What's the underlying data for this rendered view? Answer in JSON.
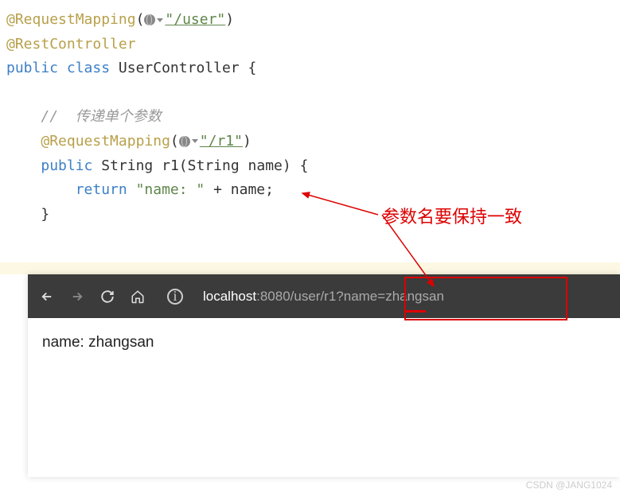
{
  "code": {
    "annotation1": "RequestMapping",
    "path1": "\"/user\"",
    "annotation2": "RestController",
    "kw_public": "public",
    "kw_class": "class",
    "class_name": "UserController",
    "comment": "//  传递单个参数",
    "annotation3": "RequestMapping",
    "path2": "\"/r1\"",
    "return_type": "String",
    "method_name": "r1",
    "param_type": "String",
    "param_name": "name",
    "kw_return": "return",
    "return_str": "\"name: \"",
    "plus": " + ",
    "return_var": "name"
  },
  "annotation_label": "参数名要保持一致",
  "browser": {
    "url_host": "localhost",
    "url_rest": ":8080/user/r1?name=zhangsan",
    "body_text": "name: zhangsan"
  },
  "watermark": "CSDN @JANG1024"
}
